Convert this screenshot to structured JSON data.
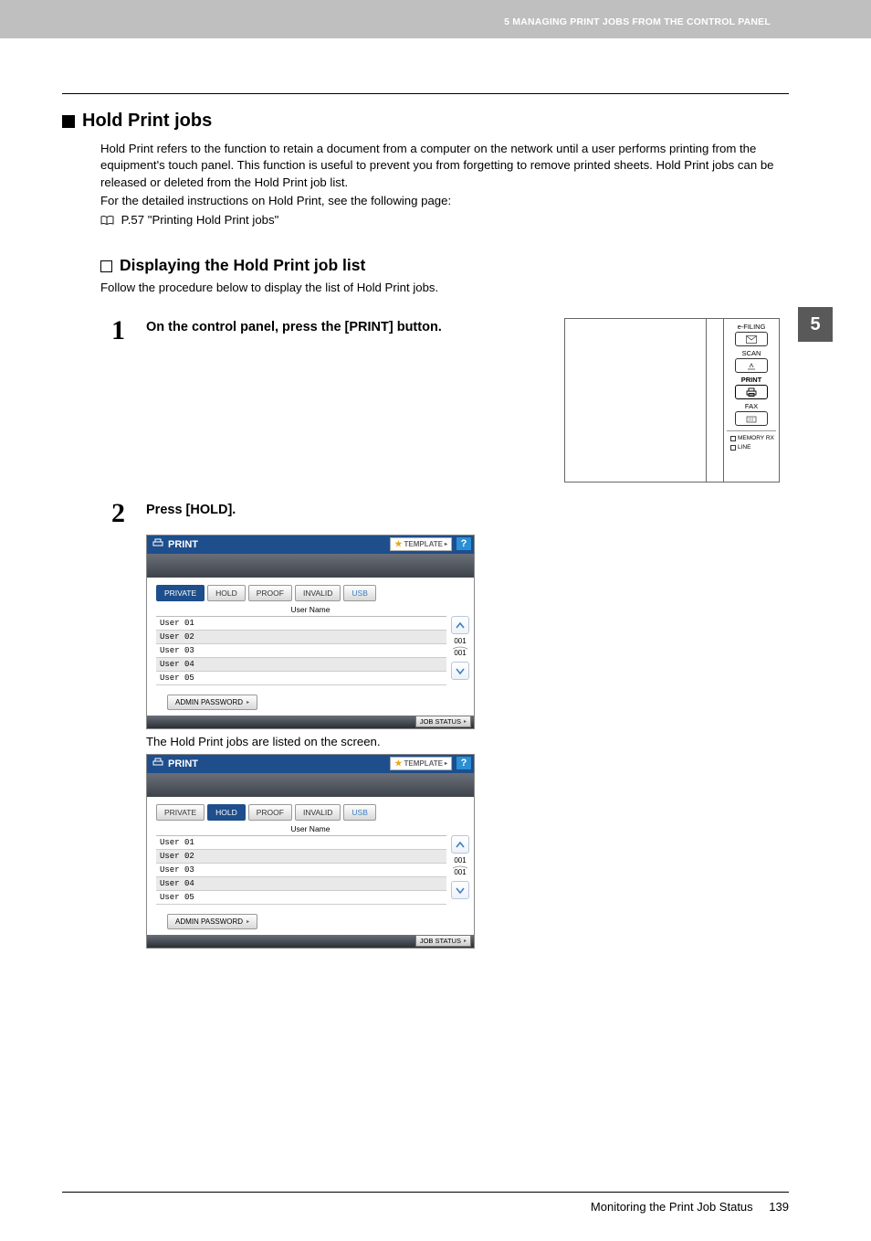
{
  "header": {
    "running_head": "5 MANAGING PRINT JOBS FROM THE CONTROL PANEL",
    "chapter_tab": "5"
  },
  "section": {
    "title": "Hold Print jobs",
    "intro1": "Hold Print refers to the function to retain a document from a computer on the network until a user performs printing from the equipment's touch panel. This function is useful to prevent you from forgetting to remove printed sheets. Hold Print jobs can be released or deleted from the Hold Print job list.",
    "intro2": "For the detailed instructions on Hold Print, see the following page:",
    "ref": "P.57 \"Printing Hold Print jobs\""
  },
  "subsection": {
    "title": "Displaying the Hold Print job list",
    "lead": "Follow the procedure below to display the list of Hold Print jobs."
  },
  "steps": {
    "s1": {
      "num": "1",
      "inst": "On the control panel, press the [PRINT] button."
    },
    "s2": {
      "num": "2",
      "inst": "Press [HOLD].",
      "result": "The Hold Print jobs are listed on the screen."
    }
  },
  "control_panel": {
    "labels": {
      "efiling": "e-FILING",
      "scan": "SCAN",
      "print": "PRINT",
      "fax": "FAX",
      "memory_rx": "MEMORY RX",
      "line": "LINE"
    }
  },
  "screen": {
    "title": "PRINT",
    "template": "TEMPLATE",
    "help": "?",
    "tabs": {
      "private": "PRIVATE",
      "hold": "HOLD",
      "proof": "PROOF",
      "invalid": "INVALID",
      "usb": "USB"
    },
    "column_header": "User Name",
    "rows": [
      "User 01",
      "User 02",
      "User 03",
      "User 04",
      "User 05"
    ],
    "admin": "ADMIN PASSWORD",
    "jobstatus": "JOB STATUS",
    "page_cur": "001",
    "page_tot": "001"
  },
  "footer": {
    "section_title": "Monitoring the Print Job Status",
    "page_no": "139"
  }
}
